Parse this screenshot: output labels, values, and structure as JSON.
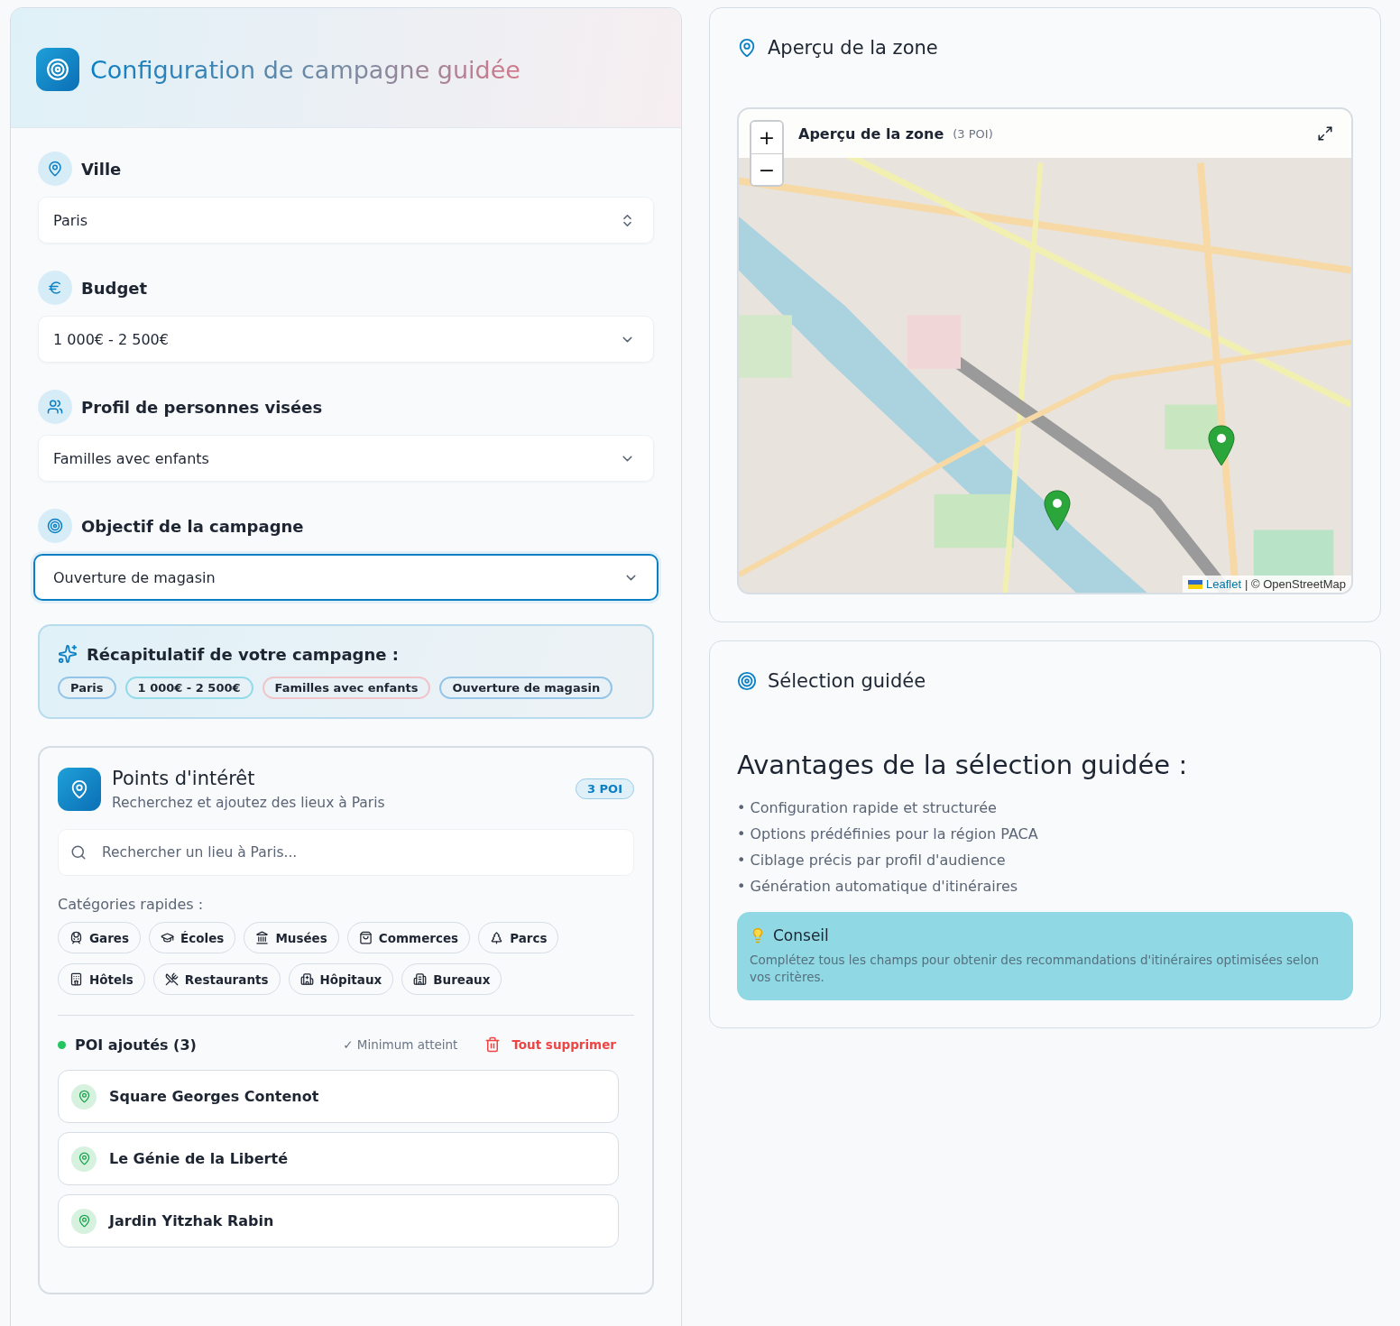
{
  "header": {
    "title": "Configuration de campagne guidée"
  },
  "fields": [
    {
      "label": "Ville",
      "value": "Paris",
      "kind": "native",
      "focused": false
    },
    {
      "label": "Budget",
      "value": "1 000€ - 2 500€",
      "kind": "dropdown",
      "focused": false
    },
    {
      "label": "Profil de personnes visées",
      "value": "Familles avec enfants",
      "kind": "dropdown",
      "focused": false
    },
    {
      "label": "Objectif de la campagne",
      "value": "Ouverture de magasin",
      "kind": "dropdown",
      "focused": true
    }
  ],
  "summary": {
    "title": "Récapitulatif de votre campagne :",
    "chips": [
      {
        "label": "Paris",
        "color": "#93c5e8"
      },
      {
        "label": "1 000€ - 2 500€",
        "color": "#93dbe8"
      },
      {
        "label": "Familles avec enfants",
        "color": "#f0c4c8"
      },
      {
        "label": "Ouverture de magasin",
        "color": "#93c5e8"
      }
    ]
  },
  "poi": {
    "title": "Points d'intérêt",
    "subtitle": "Recherchez et ajoutez des lieux à Paris",
    "badge": "3 POI",
    "search_placeholder": "Rechercher un lieu à Paris...",
    "categories_label": "Catégories rapides :",
    "categories": [
      "Gares",
      "Écoles",
      "Musées",
      "Commerces",
      "Parcs",
      "Hôtels",
      "Restaurants",
      "Hôpitaux",
      "Bureaux"
    ],
    "added_label": "POI ajoutés (3)",
    "status": "✓ Minimum atteint",
    "clear": "Tout supprimer",
    "items": [
      "Square Georges Contenot",
      "Le Génie de la Liberté",
      "Jardin Yitzhak Rabin"
    ]
  },
  "map_panel": {
    "title": "Aperçu de la zone",
    "map_title": "Aperçu de la zone",
    "map_count": "(3 POI)",
    "zoom_in": "+",
    "zoom_out": "−",
    "attribution_link": "Leaflet",
    "attribution_rest": "| © OpenStreetMap"
  },
  "guided": {
    "title": "Sélection guidée",
    "heading": "Avantages de la sélection guidée :",
    "bullets": [
      "• Configuration rapide et structurée",
      "• Options prédéfinies pour la région PACA",
      "• Ciblage précis par profil d'audience",
      "• Génération automatique d'itinéraires"
    ],
    "tip_title": "Conseil",
    "tip_text": "Complétez tous les champs pour obtenir des recommandations d'itinéraires optimisées selon vos critères."
  }
}
